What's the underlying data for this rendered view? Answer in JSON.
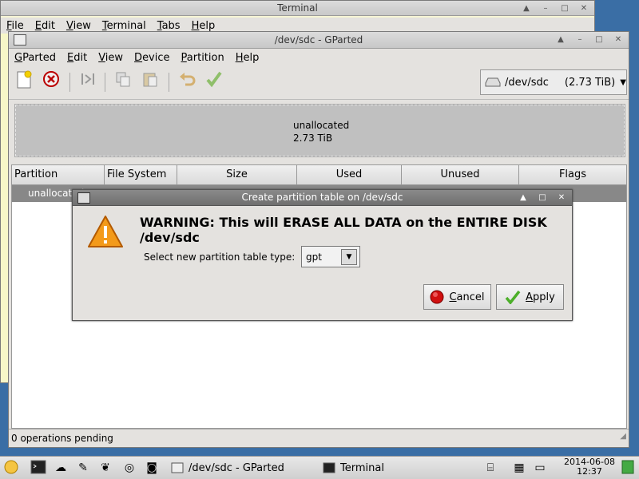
{
  "terminal": {
    "title": "Terminal",
    "menu": [
      "File",
      "Edit",
      "View",
      "Terminal",
      "Tabs",
      "Help"
    ],
    "titlebar_buttons": [
      "▲",
      "–",
      "□",
      "✕"
    ]
  },
  "gparted": {
    "title": "/dev/sdc - GParted",
    "menu": [
      "GParted",
      "Edit",
      "View",
      "Device",
      "Partition",
      "Help"
    ],
    "titlebar_buttons": [
      "▲",
      "–",
      "□",
      "✕"
    ],
    "device": {
      "name": "/dev/sdc",
      "size": "(2.73 TiB)"
    },
    "disk_graphic": {
      "label": "unallocated",
      "size": "2.73 TiB"
    },
    "columns": [
      "Partition",
      "File System",
      "Size",
      "Used",
      "Unused",
      "Flags"
    ],
    "rows": [
      {
        "partition": "unallocated"
      }
    ],
    "status": "0 operations pending"
  },
  "dialog": {
    "title": "Create partition table on /dev/sdc",
    "titlebar_buttons": [
      "▲",
      "□",
      "✕"
    ],
    "warning": "WARNING:  This will ERASE ALL DATA on the ENTIRE DISK /dev/sdc",
    "select_label": "Select new partition table type:",
    "selected_type": "gpt",
    "cancel_label": "Cancel",
    "apply_label": "Apply"
  },
  "taskbar": {
    "tasks": [
      {
        "label": "/dev/sdc - GParted"
      },
      {
        "label": "Terminal"
      }
    ],
    "clock": {
      "date": "2014-06-08",
      "time": "12:37"
    }
  },
  "colors": {
    "desktop": "#3a6ea5",
    "dialog_title": "#777777",
    "apply_check": "#4caf2a",
    "cancel_red": "#d01010"
  }
}
